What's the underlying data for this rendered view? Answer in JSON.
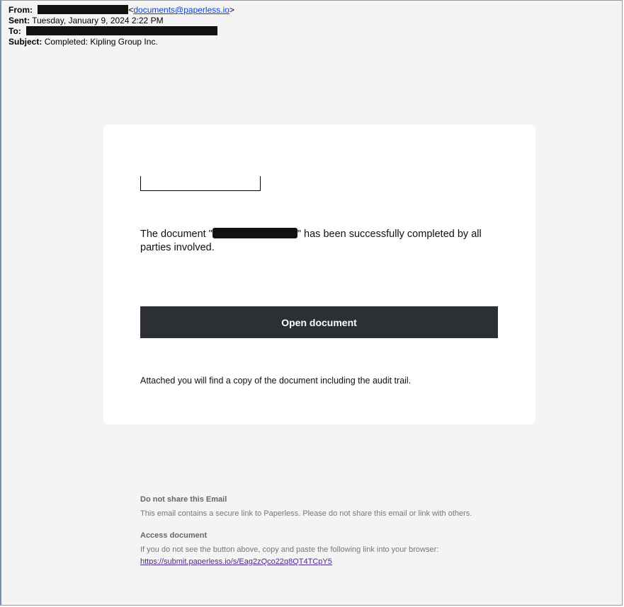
{
  "email": {
    "from_label": "From:",
    "from_address": "<documents@paperless.io>",
    "from_link_text": "documents@paperless.io",
    "sent_label": "Sent:",
    "sent_value": "Tuesday, January 9, 2024 2:22 PM",
    "to_label": "To:",
    "subject_label": "Subject:",
    "subject_value": "Completed: Kipling Group Inc."
  },
  "card": {
    "message_before": "The document \"",
    "message_after": "\" has been successfully completed by all parties involved.",
    "button_label": "Open document",
    "attached_text": "Attached you will find a copy of the document including the audit trail."
  },
  "footer": {
    "share_title": "Do not share this Email",
    "share_text": "This email contains a secure link to Paperless. Please do not share this email or link with others.",
    "access_title": "Access document",
    "access_text": "If you do not see the button above, copy and paste the following link into your browser:",
    "access_link": "https://submit.paperless.io/s/Eag2zQco22q8QT4TCpY5"
  },
  "colors": {
    "background": "#f4f4f4",
    "card": "#ffffff",
    "button": "#2c2f33",
    "link": "#0b3fd6"
  }
}
